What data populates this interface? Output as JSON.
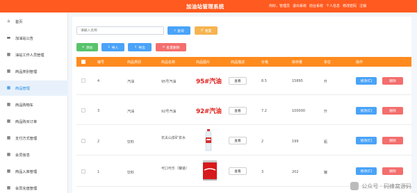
{
  "header": {
    "title": "加油站管理系统",
    "nav": [
      "你好，管理员",
      "退出系统",
      "前台系统",
      "个人信息",
      "修改密码",
      "注销"
    ]
  },
  "sidebar": {
    "items": [
      {
        "label": "首页",
        "icon": "home-icon"
      },
      {
        "label": "加油站公告",
        "icon": "chat-icon"
      },
      {
        "label": "油站工作人员管理",
        "icon": "grid-icon"
      },
      {
        "label": "商品类别管理",
        "icon": "grid-icon"
      },
      {
        "label": "商品管理",
        "icon": "grid-icon",
        "active": true
      },
      {
        "label": "商品购物车",
        "icon": "grid-icon"
      },
      {
        "label": "商品购买订单",
        "icon": "grid-icon"
      },
      {
        "label": "支付方式管理",
        "icon": "grid-icon"
      },
      {
        "label": "会员信息",
        "icon": "grid-icon"
      },
      {
        "label": "商品入库管理",
        "icon": "grid-icon"
      },
      {
        "label": "会员充值管理",
        "icon": "grid-icon"
      }
    ]
  },
  "toolbar": {
    "search_placeholder": "请输入名称",
    "search_label": "查询",
    "reset_label": "重置",
    "add_label": "添加",
    "import_label": "导入",
    "export_label": "导出",
    "batch_delete_label": "批量删除"
  },
  "table": {
    "headers": [
      "编号",
      "商品类别",
      "商品名称",
      "商品图片",
      "商品描述",
      "价格",
      "库存量",
      "单位",
      "操作"
    ],
    "view_label": "查看",
    "edit_label": "修改(C)",
    "delete_label": "删除",
    "rows": [
      {
        "id": "4",
        "category": "汽油",
        "name": "95号汽油",
        "image_text": "95#汽油",
        "price": "8.5",
        "stock": "15895",
        "unit": "升"
      },
      {
        "id": "3",
        "category": "汽油",
        "name": "92号汽油",
        "image_text": "92#汽油",
        "price": "7.2",
        "stock": "100000",
        "unit": "升"
      },
      {
        "id": "2",
        "category": "饮料",
        "name": "农夫山泉矿泉水",
        "image_text": "",
        "price": "2",
        "stock": "199",
        "unit": "瓶"
      },
      {
        "id": "1",
        "category": "饮料",
        "name": "可口可乐（罐装）",
        "image_text": "",
        "price": "3",
        "stock": "202",
        "unit": "罐"
      }
    ]
  },
  "watermark": {
    "text": "公众号 · 码蜂窝源码"
  },
  "colors": {
    "header": "#ff5a1f",
    "table_header": "#ff8a1e",
    "primary": "#4aa3f8",
    "danger": "#f46e6e",
    "success": "#58c36c",
    "warning": "#f5b450"
  }
}
